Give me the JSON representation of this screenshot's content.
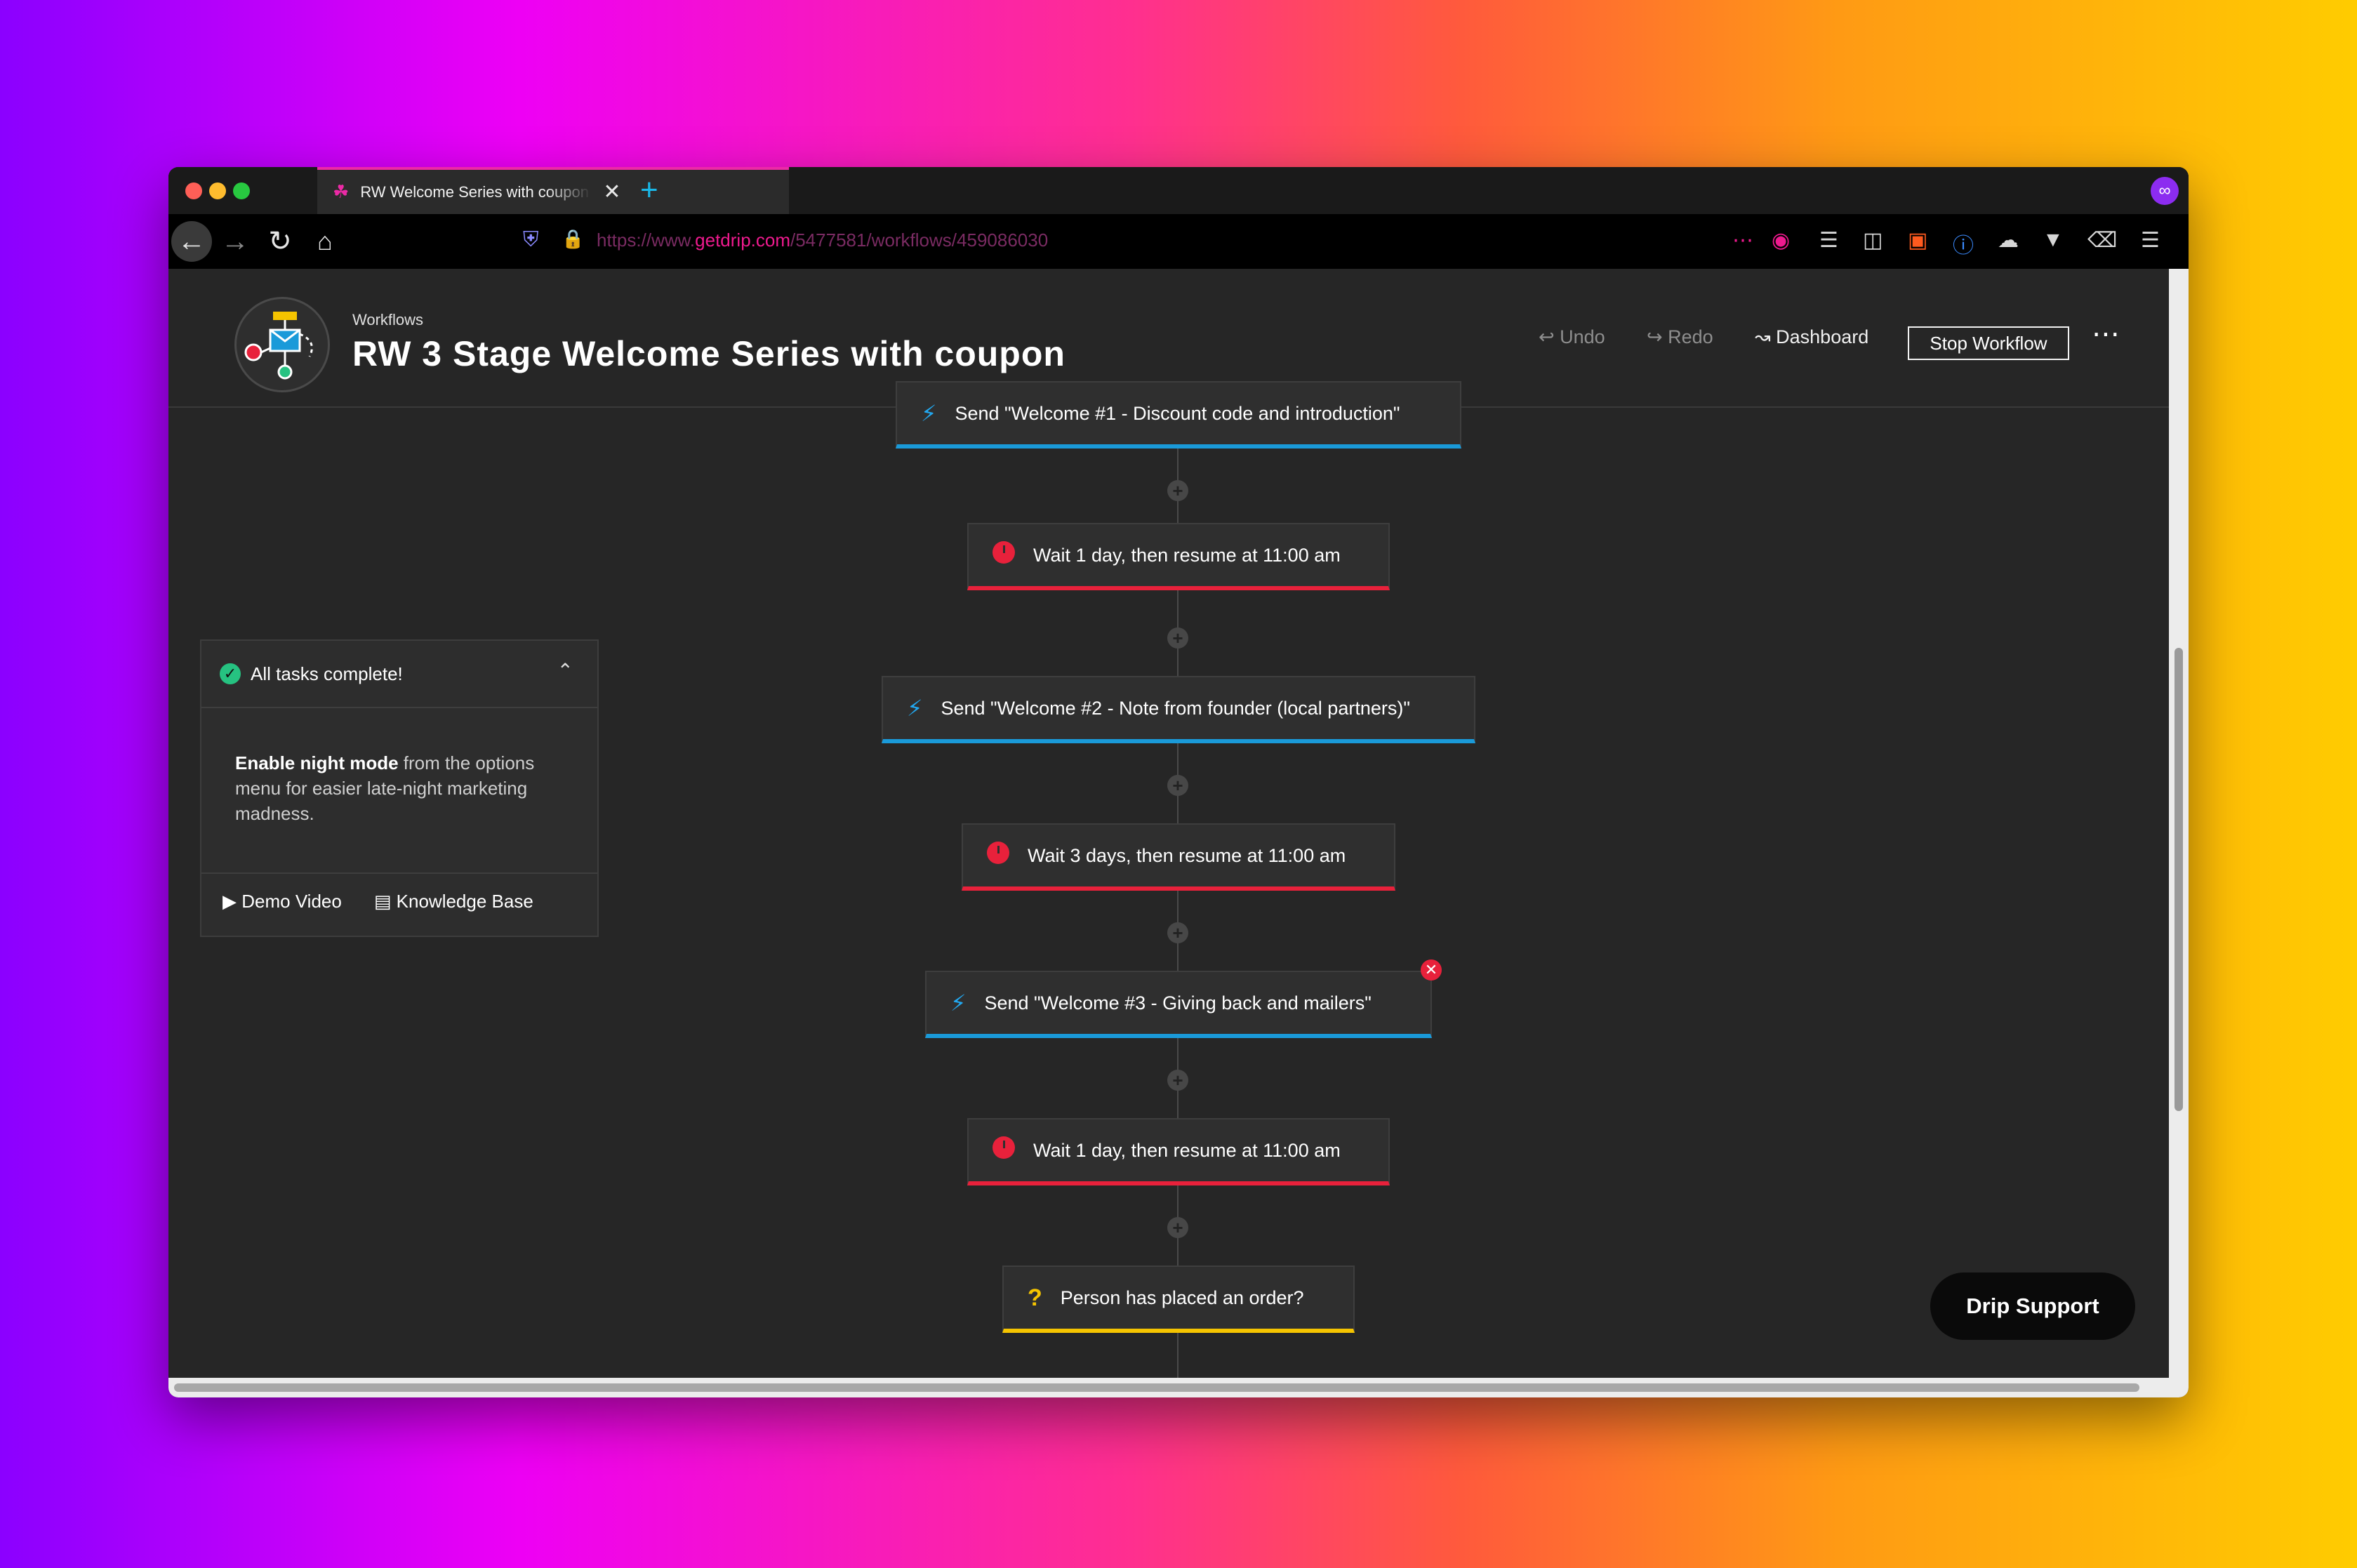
{
  "browser": {
    "tab_title": "RW Welcome Series with coupon",
    "url_prefix": "https://www.",
    "url_domain": "getdrip.com",
    "url_path": "/5477581/workflows/459086030"
  },
  "header": {
    "breadcrumb": "Workflows",
    "title": "RW 3 Stage Welcome Series with coupon",
    "undo": "Undo",
    "redo": "Redo",
    "dashboard": "Dashboard",
    "stop": "Stop Workflow"
  },
  "tasks": {
    "heading": "All tasks complete!",
    "tip_bold": "Enable night mode",
    "tip_rest": " from the options menu for easier late-night marketing madness.",
    "demo_video": "Demo Video",
    "knowledge_base": "Knowledge Base"
  },
  "workflow": {
    "nodes": [
      {
        "type": "email",
        "label": "Send \"Welcome #1 - Discount code and introduction\""
      },
      {
        "type": "wait",
        "label": "Wait 1 day, then resume at 11:00 am"
      },
      {
        "type": "email",
        "label": "Send \"Welcome #2 - Note from founder (local partners)\""
      },
      {
        "type": "wait",
        "label": "Wait 3 days, then resume at 11:00 am"
      },
      {
        "type": "email",
        "label": "Send \"Welcome #3 - Giving back and mailers\""
      },
      {
        "type": "wait",
        "label": "Wait 1 day, then resume at 11:00 am"
      },
      {
        "type": "decision",
        "label": "Person has placed an order?"
      }
    ]
  },
  "support": {
    "label": "Drip Support"
  },
  "colors": {
    "email_accent": "#1a9ad9",
    "wait_accent": "#e8213b",
    "decision_accent": "#f5c400",
    "tab_accent": "#ec2aa6"
  }
}
